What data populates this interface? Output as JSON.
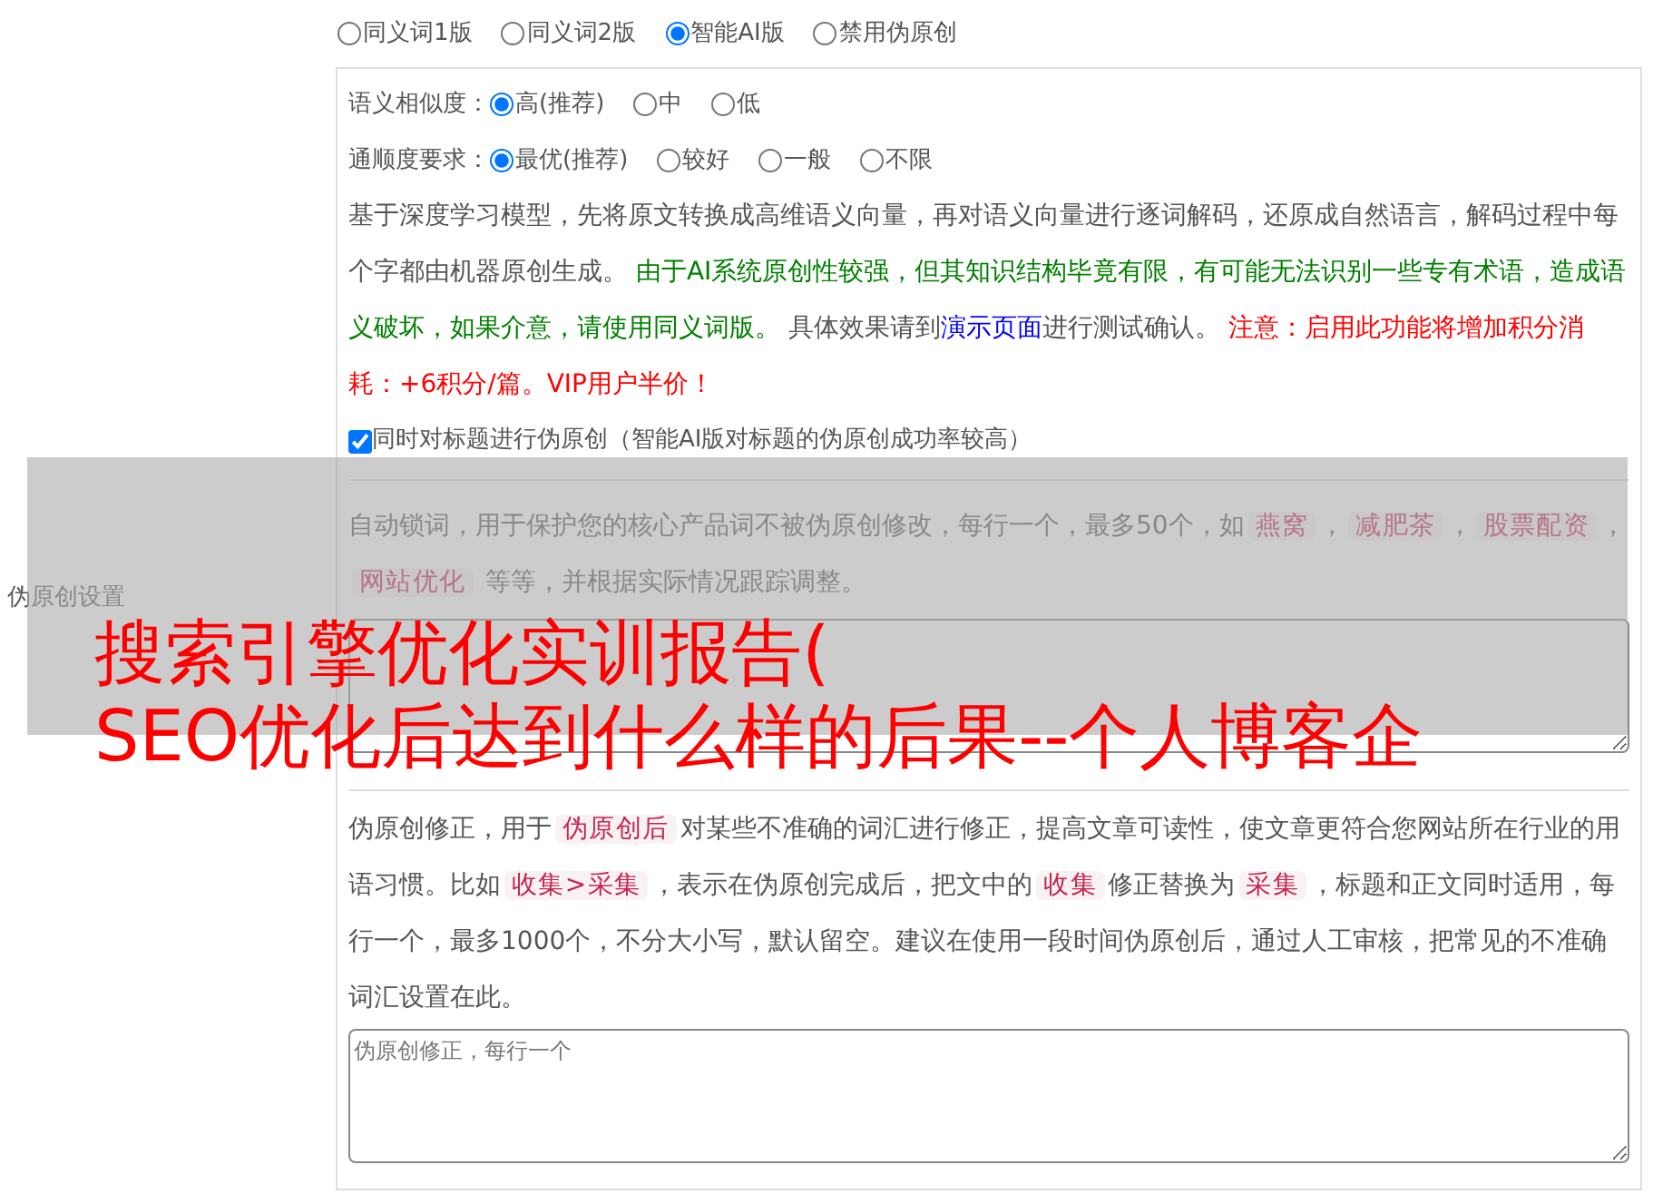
{
  "side_label": "伪原创设置",
  "mode_options": [
    {
      "label": "同义词1版",
      "selected": false
    },
    {
      "label": "同义词2版",
      "selected": false
    },
    {
      "label": "智能AI版",
      "selected": true
    },
    {
      "label": "禁用伪原创",
      "selected": false
    }
  ],
  "similarity": {
    "label": "语义相似度：",
    "options": [
      {
        "label": "高(推荐)",
        "selected": true
      },
      {
        "label": "中",
        "selected": false
      },
      {
        "label": "低",
        "selected": false
      }
    ]
  },
  "fluency": {
    "label": "通顺度要求：",
    "options": [
      {
        "label": "最优(推荐)",
        "selected": true
      },
      {
        "label": "较好",
        "selected": false
      },
      {
        "label": "一般",
        "selected": false
      },
      {
        "label": "不限",
        "selected": false
      }
    ]
  },
  "ai_description": [
    {
      "kind": "plain",
      "text": "基于深度学习模型，先将原文转换成高维语义向量，再对语义向量进行逐词解码，还原成自然语言，解码过程中每个字都由机器原创生成。 "
    },
    {
      "kind": "green",
      "text": "由于AI系统原创性较强，但其知识结构毕竟有限，有可能无法识别一些专有术语，造成语义破坏，如果介意，请使用同义词版。"
    },
    {
      "kind": "plain",
      "text": " 具体效果请到"
    },
    {
      "kind": "link",
      "text": "演示页面"
    },
    {
      "kind": "plain",
      "text": "进行测试确认。 "
    },
    {
      "kind": "red",
      "text": "注意：启用此功能将增加积分消耗：+6积分/篇。VIP用户半价！"
    }
  ],
  "title_checkbox": {
    "label": "同时对标题进行伪原创（智能AI版对标题的伪原创成功率较高）",
    "checked": true
  },
  "lock_description": [
    {
      "kind": "plain",
      "text": "自动锁词，用于保护您的核心产品词不被伪原创修改，每行一个，最多50个，如"
    },
    {
      "kind": "code",
      "text": "燕窝"
    },
    {
      "kind": "plain",
      "text": "，"
    },
    {
      "kind": "code",
      "text": "减肥茶"
    },
    {
      "kind": "plain",
      "text": "，"
    },
    {
      "kind": "code",
      "text": "股票配资"
    },
    {
      "kind": "plain",
      "text": "，"
    },
    {
      "kind": "code",
      "text": "网站优化"
    },
    {
      "kind": "plain",
      "text": " 等等，并根据实际情况跟踪调整。"
    }
  ],
  "correction_description": [
    {
      "kind": "plain",
      "text": "伪原创修正，用于"
    },
    {
      "kind": "code",
      "text": "伪原创后"
    },
    {
      "kind": "plain",
      "text": "对某些不准确的词汇进行修正，提高文章可读性，使文章更符合您网站所在行业的用语习惯。比如"
    },
    {
      "kind": "code",
      "text": "收集>采集"
    },
    {
      "kind": "plain",
      "text": "，表示在伪原创完成后，把文中的"
    },
    {
      "kind": "code",
      "text": "收集"
    },
    {
      "kind": "plain",
      "text": "修正替换为"
    },
    {
      "kind": "code",
      "text": "采集"
    },
    {
      "kind": "plain",
      "text": "，标题和正文同时适用，每行一个，最多1000个，不分大小写，默认留空。建议在使用一段时间伪原创后，通过人工审核，把常见的不准确词汇设置在此。"
    }
  ],
  "correction_field": {
    "placeholder": "伪原创修正，每行一个"
  },
  "overlay_title": [
    "搜索引擎优化实训报告(",
    "SEO优化后达到什么样的后果--个人博客企"
  ]
}
